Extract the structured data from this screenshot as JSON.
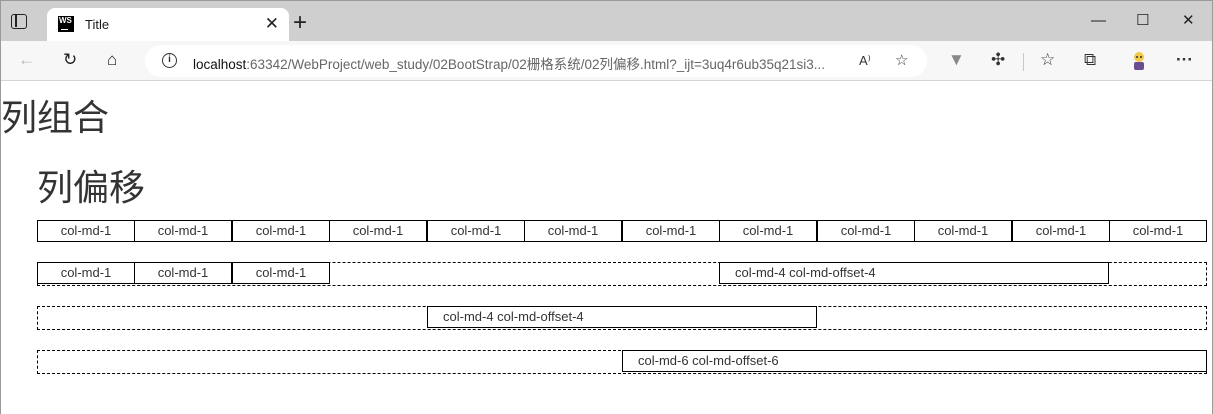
{
  "browser": {
    "tab_title": "Title",
    "favicon_text": "WS",
    "url_host": "localhost",
    "url_rest": ":63342/WebProject/web_study/02BootStrap/02栅格系统/02列偏移.html?_ijt=3uq4r6ub35q21si3..."
  },
  "page": {
    "heading1": "列组合",
    "heading2": "列偏移",
    "row1": [
      "col-md-1",
      "col-md-1",
      "col-md-1",
      "col-md-1",
      "col-md-1",
      "col-md-1",
      "col-md-1",
      "col-md-1",
      "col-md-1",
      "col-md-1",
      "col-md-1",
      "col-md-1"
    ],
    "row2": {
      "cells": [
        "col-md-1",
        "col-md-1",
        "col-md-1"
      ],
      "offset_cell": "col-md-4 col-md-offset-4"
    },
    "row3": {
      "offset_cell": "col-md-4 col-md-offset-4"
    },
    "row4": {
      "offset_cell": "col-md-6 col-md-offset-6"
    }
  }
}
